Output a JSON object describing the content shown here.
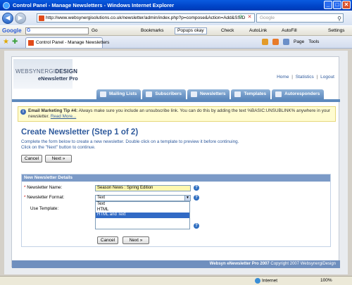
{
  "window": {
    "title": "Control Panel - Manage Newsletters - Windows Internet Explorer",
    "min": "_",
    "max": "□",
    "close": "✕"
  },
  "browser": {
    "back": "◀",
    "forward": "▶",
    "url": "http://www.websynergisolutions.co.uk/newsletter/admin/index.php?p=compose&Action=Add&SSID",
    "search_placeholder": "Google",
    "search_icon": "⚲",
    "icons": [
      "refresh-icon",
      "stop-icon"
    ]
  },
  "google_toolbar": {
    "logo": "Google",
    "badge": "G",
    "go": "Go",
    "bookmarks": "Bookmarks",
    "popups": "Popups okay",
    "check": "Check",
    "autolink": "AutoLink",
    "autofill": "AutoFill",
    "settings": "Settings"
  },
  "tabs": {
    "active": "Control Panel - Manage Newsletters",
    "page": "Page",
    "tools": "Tools"
  },
  "header": {
    "logo_light": "WEBSYNERGI",
    "logo_bold": "DESIGN",
    "product": "eNewsletter Pro",
    "links": [
      "Home",
      "Statistics",
      "Logout"
    ],
    "sep": "|"
  },
  "nav": [
    {
      "label": "Mailing Lists"
    },
    {
      "label": "Subscribers"
    },
    {
      "label": "Newsletters"
    },
    {
      "label": "Templates"
    },
    {
      "label": "Autoresponders"
    }
  ],
  "tip": {
    "icon": "i",
    "heading": "Email Marketing Tip #4:",
    "text": " Always make sure you include an unsubscribe link. You can do this by adding the text %BASIC:UNSUBLINK% anywhere in your newsletter.",
    "link": "Read More..."
  },
  "page": {
    "title": "Create Newsletter (Step 1 of 2)",
    "intro_1": "Complete the form below to create a new newsletter. Double click on a template to preview it before continuing.",
    "intro_2": "Click on the \"Next\" button to continue."
  },
  "buttons": {
    "cancel": "Cancel",
    "next": "Next »"
  },
  "form": {
    "section_title": "New Newsletter Details",
    "name_label": "Newsletter Name:",
    "name_value": "Season News : Spring Edition",
    "format_label": "Newsletter Format:",
    "format_value": "Text",
    "format_options": [
      "Text",
      "HTML",
      "HTML and Text"
    ],
    "format_selected": "HTML and Text",
    "template_label": "Use Template:",
    "required": "*",
    "help": "?"
  },
  "footer": {
    "product": "Websyn eNewsletter Pro 2007",
    "copyright": " Copyright 2007 WebsynergiDesign"
  },
  "status": {
    "zone": "Internet",
    "zoom": "100%"
  }
}
